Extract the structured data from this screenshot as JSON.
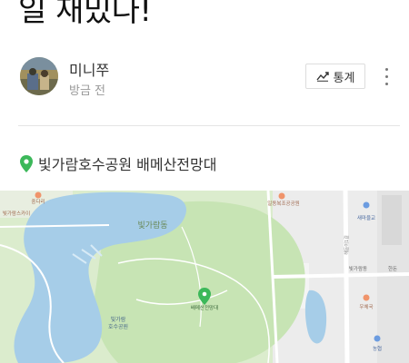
{
  "post": {
    "title_line": "일 재밌다!"
  },
  "author": {
    "name": "미니쭈",
    "time": "방금 전"
  },
  "actions": {
    "stats_label": "통계"
  },
  "place": {
    "name": "빛가람호수공원 배메산전망대"
  },
  "map": {
    "labels": {
      "district": "빛가람동",
      "park": "빛가람\n호수공원",
      "park_line1": "빛가람",
      "park_line2": "호수공원",
      "observatory": "배메산전망대",
      "top_left": "중다리",
      "top_left2": "빛가람스카이",
      "top_right": "일동복조공공원",
      "right1": "새마을교",
      "right2": "빛가람동",
      "right3": "한돈",
      "right4": "우체국",
      "right5": "농협",
      "right6": "해돋이1길"
    },
    "pin_color": "#3cb85a"
  },
  "colors": {
    "accent_green": "#3cb85a",
    "water": "#a9cfe8",
    "park": "#c4e3b0"
  }
}
